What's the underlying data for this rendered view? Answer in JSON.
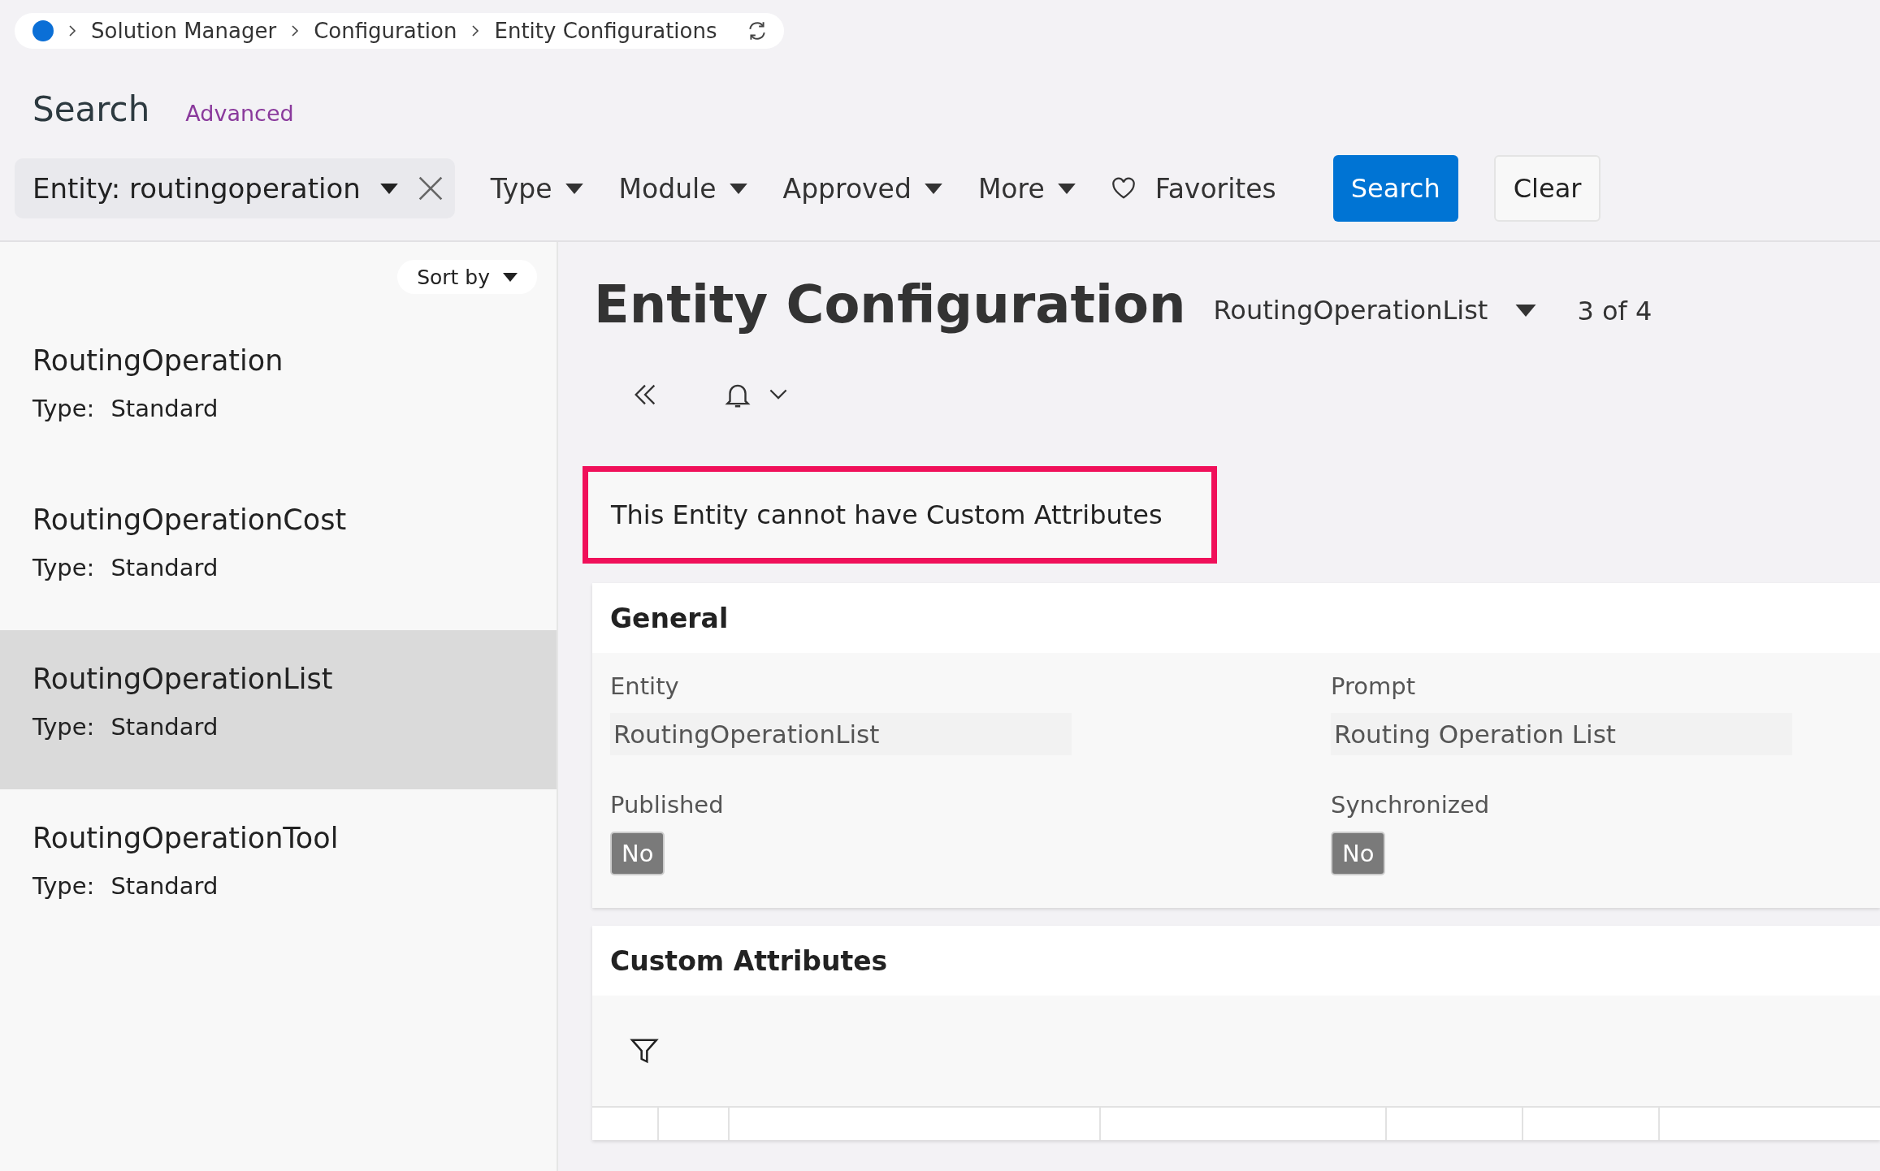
{
  "breadcrumb": {
    "items": [
      "Solution Manager",
      "Configuration",
      "Entity Configurations"
    ]
  },
  "search": {
    "title": "Search",
    "advanced_link": "Advanced"
  },
  "filter_bar": {
    "entity_filter": {
      "label": "Entity: routingoperation"
    },
    "dropdowns": [
      "Type",
      "Module",
      "Approved",
      "More"
    ],
    "favorites": "Favorites",
    "buttons": [
      {
        "label": "Search",
        "kind": "primary"
      },
      {
        "label": "Clear",
        "kind": "secondary"
      }
    ]
  },
  "sidebar": {
    "sort_label": "Sort by",
    "items": [
      {
        "name": "RoutingOperation",
        "type_label": "Type:",
        "type_value": "Standard",
        "selected": false
      },
      {
        "name": "RoutingOperationCost",
        "type_label": "Type:",
        "type_value": "Standard",
        "selected": false
      },
      {
        "name": "RoutingOperationList",
        "type_label": "Type:",
        "type_value": "Standard",
        "selected": true
      },
      {
        "name": "RoutingOperationTool",
        "type_label": "Type:",
        "type_value": "Standard",
        "selected": false
      }
    ]
  },
  "main": {
    "title": "Entity Configuration",
    "record_selector": "RoutingOperationList",
    "position": "3 of 4",
    "notice": "This Entity cannot have Custom Attributes",
    "general": {
      "title": "General",
      "fields": [
        {
          "label": "Entity",
          "value": "RoutingOperationList",
          "kind": "text"
        },
        {
          "label": "Prompt",
          "value": "Routing Operation List",
          "kind": "text"
        },
        {
          "label": "Published",
          "value": "No",
          "kind": "badge"
        },
        {
          "label": "Synchronized",
          "value": "No",
          "kind": "badge"
        }
      ]
    },
    "custom_attributes": {
      "title": "Custom Attributes"
    }
  }
}
